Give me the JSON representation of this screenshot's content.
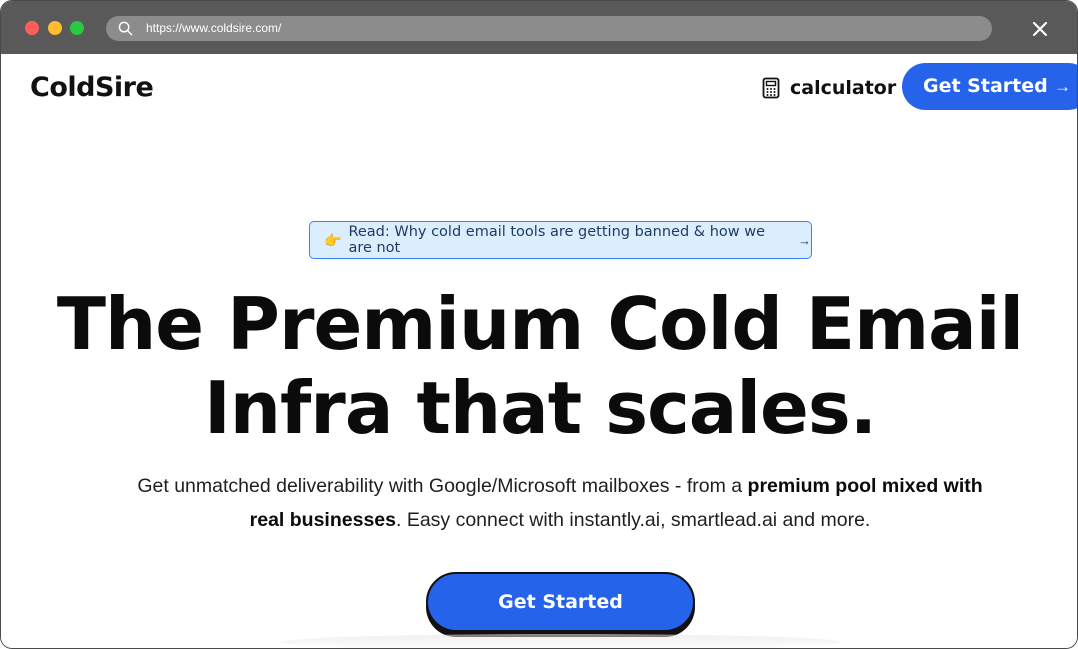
{
  "browser": {
    "url": "https://www.coldsire.com/"
  },
  "nav": {
    "logo": "ColdSire",
    "calculator_label": "calculator",
    "cta_label": "Get Started",
    "cta_arrow": "→"
  },
  "hero": {
    "announcement_emoji": "👉",
    "announcement_text": "Read: Why cold email tools are getting banned & how we are not",
    "announcement_arrow": "→",
    "headline_line1": "The Premium Cold Email",
    "headline_line2": "Infra that scales.",
    "sub_part1": "Get unmatched deliverability with Google/Microsoft mailboxes - from a ",
    "sub_bold": "premium pool mixed with real businesses",
    "sub_part2": ". Easy connect with instantly.ai, smartlead.ai and more.",
    "cta_label": "Get Started"
  },
  "colors": {
    "accent": "#2563eb",
    "announcement_bg": "#dbeefe",
    "titlebar": "#595959"
  }
}
